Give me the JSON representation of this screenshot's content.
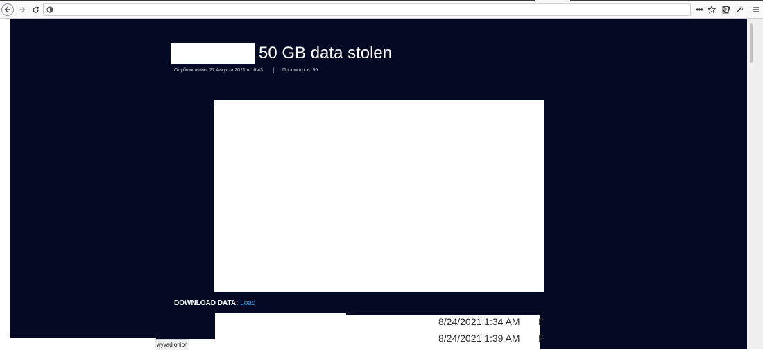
{
  "browser": {
    "url": "",
    "icons": {
      "back": "back-arrow-icon",
      "forward": "forward-arrow-icon",
      "reload": "reload-icon",
      "identity": "site-identity-icon",
      "reader": "reader-view-icon",
      "more": "more-actions-icon",
      "bookmark": "star-icon",
      "tracking": "shield-icon",
      "customize": "wand-icon",
      "menu": "hamburger-menu-icon"
    }
  },
  "post": {
    "title": "50 GB data stolen",
    "published": "Опубликовано: 27 Августа 2021 в 16:43",
    "views": "Просмотров: 96",
    "download_label": "DOWNLOAD DATA:",
    "download_link": "Load"
  },
  "screenshot_fragment": {
    "rows": [
      {
        "date": "8/24/2021 1:34 AM",
        "col": "F"
      },
      {
        "date": "8/24/2021 1:39 AM",
        "col": "F"
      }
    ]
  },
  "status": {
    "link_preview": "wyyad.onion"
  },
  "colors": {
    "page_background": "#040a24",
    "link": "#3aa0f0"
  }
}
